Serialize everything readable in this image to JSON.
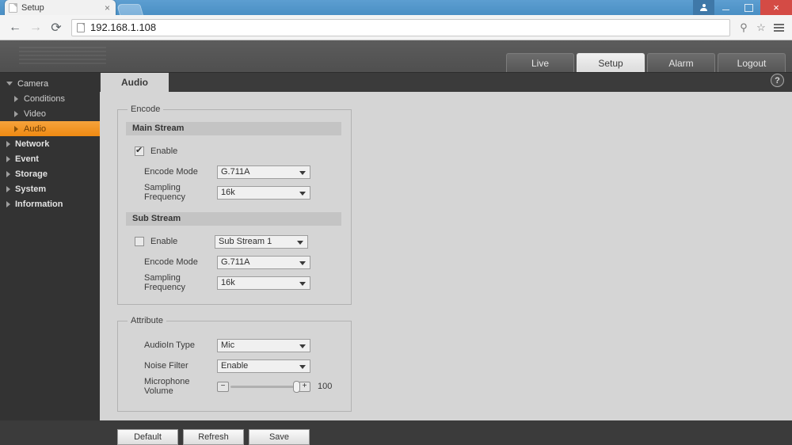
{
  "browser": {
    "tab_title": "Setup",
    "tab_close_label": "×",
    "back_label": "←",
    "forward_label": "→",
    "reload_label": "⟳",
    "url": "192.168.1.108",
    "key_icon": "key-icon",
    "star_icon": "star-icon",
    "menu_icon": "hamburger-menu-icon",
    "minimize_label": "",
    "maximize_label": "",
    "close_label": "×"
  },
  "device_nav": {
    "items": [
      {
        "label": "Live",
        "active": false
      },
      {
        "label": "Setup",
        "active": true
      },
      {
        "label": "Alarm",
        "active": false
      },
      {
        "label": "Logout",
        "active": false
      }
    ]
  },
  "sidebar": {
    "camera": {
      "label": "Camera"
    },
    "camera_children": [
      {
        "label": "Conditions",
        "selected": false
      },
      {
        "label": "Video",
        "selected": false
      },
      {
        "label": "Audio",
        "selected": true
      }
    ],
    "top_items": [
      {
        "label": "Network"
      },
      {
        "label": "Event"
      },
      {
        "label": "Storage"
      },
      {
        "label": "System"
      },
      {
        "label": "Information"
      }
    ]
  },
  "content": {
    "tab_label": "Audio",
    "help_label": "?"
  },
  "encode": {
    "legend": "Encode",
    "main_stream": {
      "heading": "Main Stream",
      "enable_label": "Enable",
      "enable_checked": true,
      "encode_mode_label": "Encode Mode",
      "encode_mode_value": "G.711A",
      "sampling_label": "Sampling Frequency",
      "sampling_value": "16k"
    },
    "sub_stream": {
      "heading": "Sub Stream",
      "enable_label": "Enable",
      "enable_checked": false,
      "stream_select_value": "Sub Stream 1",
      "encode_mode_label": "Encode Mode",
      "encode_mode_value": "G.711A",
      "sampling_label": "Sampling Frequency",
      "sampling_value": "16k"
    }
  },
  "attribute": {
    "legend": "Attribute",
    "audioin_label": "AudioIn Type",
    "audioin_value": "Mic",
    "noise_label": "Noise Filter",
    "noise_value": "Enable",
    "mic_volume_label": "Microphone Volume",
    "mic_volume_value": "100",
    "minus_label": "−",
    "plus_label": "+"
  },
  "actions": {
    "default_label": "Default",
    "refresh_label": "Refresh",
    "save_label": "Save"
  },
  "colors": {
    "accent": "#ef8a12",
    "panel_bg": "#d5d5d5",
    "chrome_dark": "#333333"
  }
}
